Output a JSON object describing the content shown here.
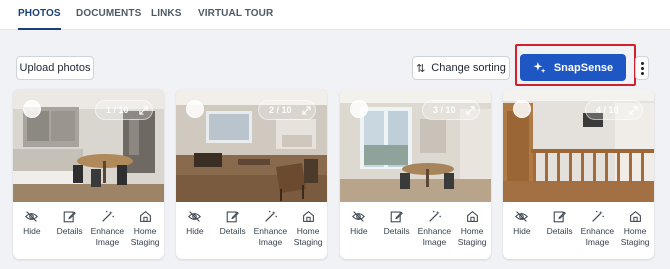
{
  "tabs": [
    {
      "label": "PHOTOS",
      "active": true
    },
    {
      "label": "DOCUMENTS",
      "active": false
    },
    {
      "label": "LINKS",
      "active": false
    },
    {
      "label": "VIRTUAL TOUR",
      "active": false
    }
  ],
  "toolbar": {
    "upload_label": "Upload photos",
    "sort_label": "Change sorting",
    "snapsense_label": "SnapSense",
    "accent_color": "#1e56c4",
    "highlight_color": "#d4202a"
  },
  "photos": [
    {
      "counter": "1 / 10",
      "scene": "kitchen-dining"
    },
    {
      "counter": "2 / 10",
      "scene": "living-room"
    },
    {
      "counter": "3 / 10",
      "scene": "dining-window"
    },
    {
      "counter": "4 / 10",
      "scene": "staircase"
    }
  ],
  "actions": {
    "hide": "Hide",
    "details": "Details",
    "enhance_1": "Enhance",
    "enhance_2": "Image",
    "staging_1": "Home",
    "staging_2": "Staging"
  }
}
